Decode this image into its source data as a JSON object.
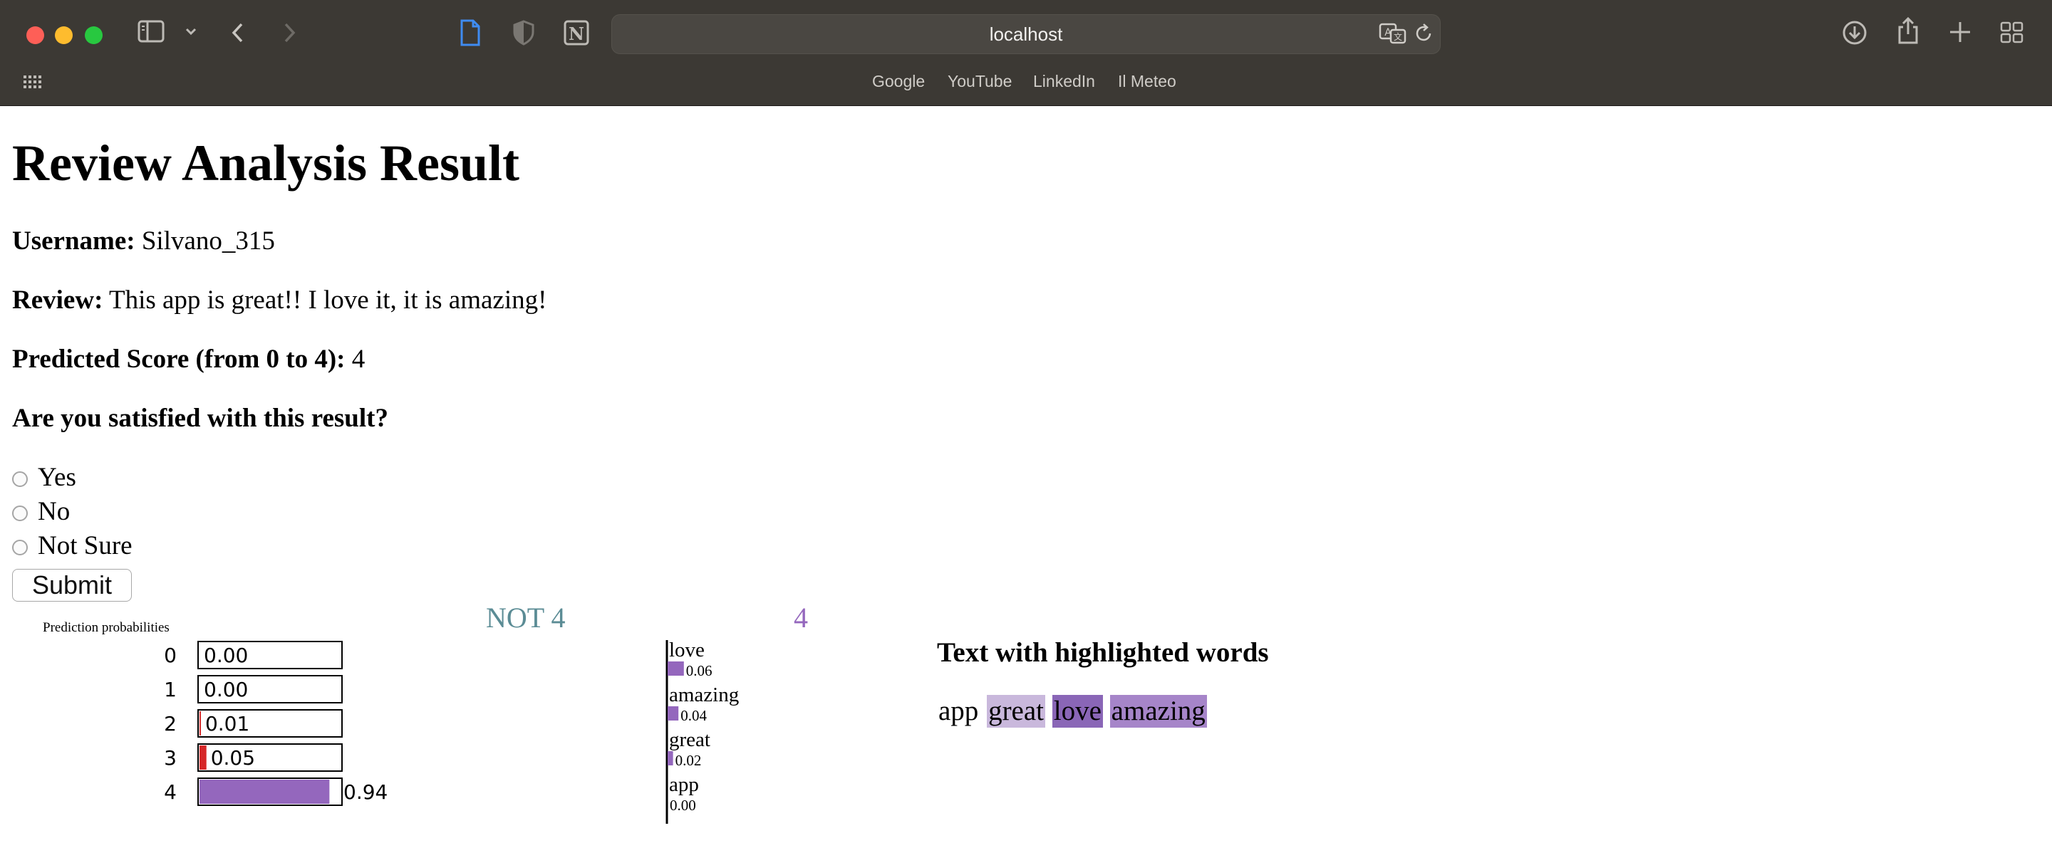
{
  "browser": {
    "url": "localhost",
    "favorites": [
      "Google",
      "YouTube",
      "LinkedIn",
      "Il Meteo"
    ]
  },
  "page": {
    "title": "Review Analysis Result",
    "username_label": "Username:",
    "username_value": "Silvano_315",
    "review_label": "Review:",
    "review_value": "This app is great!! I love it, it is amazing!",
    "score_label": "Predicted Score (from 0 to 4):",
    "score_value": "4",
    "question": "Are you satisfied with this result?",
    "options": [
      "Yes",
      "No",
      "Not Sure"
    ],
    "submit_label": "Submit"
  },
  "colors": {
    "accent_purple": "#9467bd",
    "not_class": "#5b8c95",
    "red_bar": "#d62728"
  },
  "chart_data": [
    {
      "type": "bar",
      "title": "Prediction probabilities",
      "categories": [
        "0",
        "1",
        "2",
        "3",
        "4"
      ],
      "values": [
        0.0,
        0.0,
        0.01,
        0.05,
        0.94
      ],
      "labels": [
        "0.00",
        "0.00",
        "0.01",
        "0.05",
        "0.94"
      ],
      "colors": [
        "#d62728",
        "#d62728",
        "#d62728",
        "#d62728",
        "#9467bd"
      ],
      "xlim": [
        0,
        1
      ]
    },
    {
      "type": "bar",
      "class_labels": [
        "NOT 4",
        "4"
      ],
      "categories": [
        "love",
        "amazing",
        "great",
        "app"
      ],
      "values": [
        0.06,
        0.04,
        0.02,
        0.0
      ],
      "labels": [
        "0.06",
        "0.04",
        "0.02",
        "0.00"
      ],
      "color": "#9467bd"
    }
  ],
  "highlight": {
    "title": "Text with highlighted words",
    "words": [
      {
        "text": "app",
        "color": "transparent"
      },
      {
        "text": "great",
        "color": "#c9b8dc"
      },
      {
        "text": "love",
        "color": "#8a66b7"
      },
      {
        "text": "amazing",
        "color": "#a685c9"
      }
    ]
  }
}
